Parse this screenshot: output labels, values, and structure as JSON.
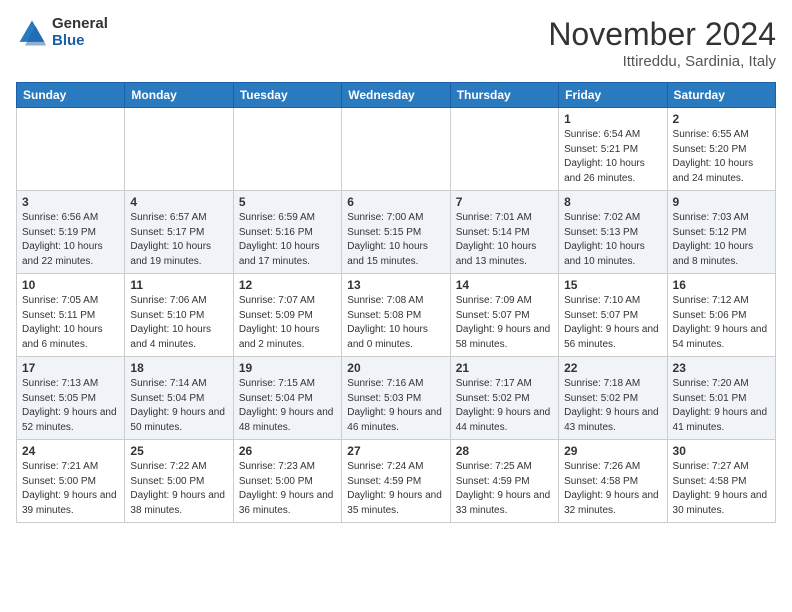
{
  "header": {
    "logo_general": "General",
    "logo_blue": "Blue",
    "title": "November 2024",
    "location": "Ittireddu, Sardinia, Italy"
  },
  "weekdays": [
    "Sunday",
    "Monday",
    "Tuesday",
    "Wednesday",
    "Thursday",
    "Friday",
    "Saturday"
  ],
  "weeks": [
    [
      {
        "day": "",
        "info": ""
      },
      {
        "day": "",
        "info": ""
      },
      {
        "day": "",
        "info": ""
      },
      {
        "day": "",
        "info": ""
      },
      {
        "day": "",
        "info": ""
      },
      {
        "day": "1",
        "info": "Sunrise: 6:54 AM\nSunset: 5:21 PM\nDaylight: 10 hours and 26 minutes."
      },
      {
        "day": "2",
        "info": "Sunrise: 6:55 AM\nSunset: 5:20 PM\nDaylight: 10 hours and 24 minutes."
      }
    ],
    [
      {
        "day": "3",
        "info": "Sunrise: 6:56 AM\nSunset: 5:19 PM\nDaylight: 10 hours and 22 minutes."
      },
      {
        "day": "4",
        "info": "Sunrise: 6:57 AM\nSunset: 5:17 PM\nDaylight: 10 hours and 19 minutes."
      },
      {
        "day": "5",
        "info": "Sunrise: 6:59 AM\nSunset: 5:16 PM\nDaylight: 10 hours and 17 minutes."
      },
      {
        "day": "6",
        "info": "Sunrise: 7:00 AM\nSunset: 5:15 PM\nDaylight: 10 hours and 15 minutes."
      },
      {
        "day": "7",
        "info": "Sunrise: 7:01 AM\nSunset: 5:14 PM\nDaylight: 10 hours and 13 minutes."
      },
      {
        "day": "8",
        "info": "Sunrise: 7:02 AM\nSunset: 5:13 PM\nDaylight: 10 hours and 10 minutes."
      },
      {
        "day": "9",
        "info": "Sunrise: 7:03 AM\nSunset: 5:12 PM\nDaylight: 10 hours and 8 minutes."
      }
    ],
    [
      {
        "day": "10",
        "info": "Sunrise: 7:05 AM\nSunset: 5:11 PM\nDaylight: 10 hours and 6 minutes."
      },
      {
        "day": "11",
        "info": "Sunrise: 7:06 AM\nSunset: 5:10 PM\nDaylight: 10 hours and 4 minutes."
      },
      {
        "day": "12",
        "info": "Sunrise: 7:07 AM\nSunset: 5:09 PM\nDaylight: 10 hours and 2 minutes."
      },
      {
        "day": "13",
        "info": "Sunrise: 7:08 AM\nSunset: 5:08 PM\nDaylight: 10 hours and 0 minutes."
      },
      {
        "day": "14",
        "info": "Sunrise: 7:09 AM\nSunset: 5:07 PM\nDaylight: 9 hours and 58 minutes."
      },
      {
        "day": "15",
        "info": "Sunrise: 7:10 AM\nSunset: 5:07 PM\nDaylight: 9 hours and 56 minutes."
      },
      {
        "day": "16",
        "info": "Sunrise: 7:12 AM\nSunset: 5:06 PM\nDaylight: 9 hours and 54 minutes."
      }
    ],
    [
      {
        "day": "17",
        "info": "Sunrise: 7:13 AM\nSunset: 5:05 PM\nDaylight: 9 hours and 52 minutes."
      },
      {
        "day": "18",
        "info": "Sunrise: 7:14 AM\nSunset: 5:04 PM\nDaylight: 9 hours and 50 minutes."
      },
      {
        "day": "19",
        "info": "Sunrise: 7:15 AM\nSunset: 5:04 PM\nDaylight: 9 hours and 48 minutes."
      },
      {
        "day": "20",
        "info": "Sunrise: 7:16 AM\nSunset: 5:03 PM\nDaylight: 9 hours and 46 minutes."
      },
      {
        "day": "21",
        "info": "Sunrise: 7:17 AM\nSunset: 5:02 PM\nDaylight: 9 hours and 44 minutes."
      },
      {
        "day": "22",
        "info": "Sunrise: 7:18 AM\nSunset: 5:02 PM\nDaylight: 9 hours and 43 minutes."
      },
      {
        "day": "23",
        "info": "Sunrise: 7:20 AM\nSunset: 5:01 PM\nDaylight: 9 hours and 41 minutes."
      }
    ],
    [
      {
        "day": "24",
        "info": "Sunrise: 7:21 AM\nSunset: 5:00 PM\nDaylight: 9 hours and 39 minutes."
      },
      {
        "day": "25",
        "info": "Sunrise: 7:22 AM\nSunset: 5:00 PM\nDaylight: 9 hours and 38 minutes."
      },
      {
        "day": "26",
        "info": "Sunrise: 7:23 AM\nSunset: 5:00 PM\nDaylight: 9 hours and 36 minutes."
      },
      {
        "day": "27",
        "info": "Sunrise: 7:24 AM\nSunset: 4:59 PM\nDaylight: 9 hours and 35 minutes."
      },
      {
        "day": "28",
        "info": "Sunrise: 7:25 AM\nSunset: 4:59 PM\nDaylight: 9 hours and 33 minutes."
      },
      {
        "day": "29",
        "info": "Sunrise: 7:26 AM\nSunset: 4:58 PM\nDaylight: 9 hours and 32 minutes."
      },
      {
        "day": "30",
        "info": "Sunrise: 7:27 AM\nSunset: 4:58 PM\nDaylight: 9 hours and 30 minutes."
      }
    ]
  ]
}
